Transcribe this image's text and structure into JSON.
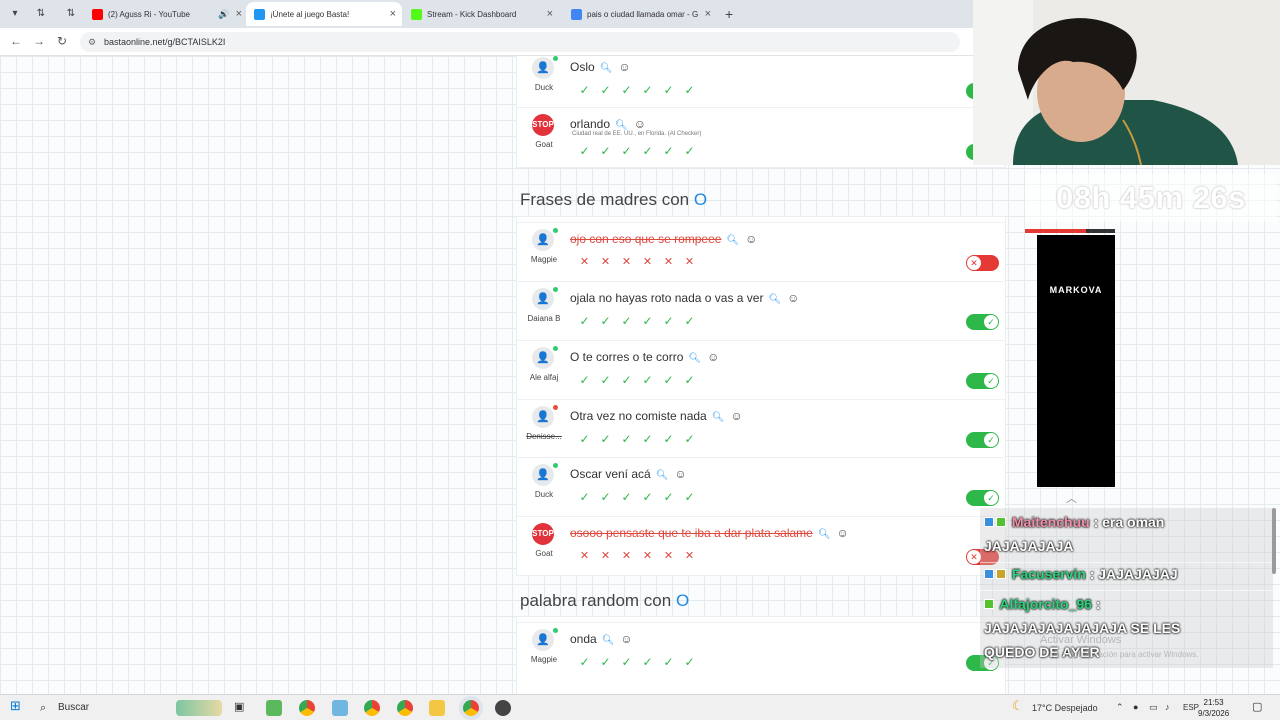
{
  "browser": {
    "tabs": [
      {
        "title": "(2) Aguss Ri - YouTube",
        "color": "#ff0000",
        "active": false,
        "audio": true
      },
      {
        "title": "¡Únete al juego Basta!",
        "color": "#2196f3",
        "active": true,
        "audio": false
      },
      {
        "title": "Stream - Kick Dashboard",
        "color": "#53fc18",
        "active": false,
        "audio": false
      },
      {
        "title": "pais o ciudad llamada omar - G",
        "color": "#4285f4",
        "active": false,
        "audio": false
      }
    ],
    "url": "bastaonline.net/g/BCTAISLK2I"
  },
  "top_rows": [
    {
      "user": "Duck",
      "answer": "Oslo",
      "avatar": "person",
      "valid": true,
      "note": "",
      "dot": "green"
    },
    {
      "user": "Goat",
      "answer": "orlando",
      "avatar": "stop",
      "valid": true,
      "note": "Ciudad real de EE. UU., en Florida. (AI Checker)",
      "dot": "none"
    }
  ],
  "sections": [
    {
      "title": "Frases de madres con",
      "letter": "O",
      "rows": [
        {
          "user": "Magpie",
          "answer": "ojo con eso que se rompeee",
          "avatar": "person",
          "valid": false,
          "dot": "green"
        },
        {
          "user": "Daiana B",
          "answer": "ojala no hayas roto nada o vas a ver",
          "avatar": "person",
          "valid": true,
          "dot": "green"
        },
        {
          "user": "Ale alfaj",
          "answer": "O te corres o te corro",
          "avatar": "person",
          "valid": true,
          "dot": "green"
        },
        {
          "user": "Denisse...",
          "answer": "Otra vez no comiste nada",
          "avatar": "person",
          "valid": true,
          "dot": "red",
          "user_strike": true
        },
        {
          "user": "Duck",
          "answer": "Oscar vení acá",
          "avatar": "person",
          "valid": true,
          "dot": "green"
        },
        {
          "user": "Goat",
          "answer": "osooo pensaste que te iba a dar plata salame",
          "avatar": "stop",
          "valid": false,
          "dot": "none"
        }
      ]
    },
    {
      "title": "palabra random con",
      "letter": "O",
      "rows": [
        {
          "user": "Magpie",
          "answer": "onda",
          "avatar": "person",
          "valid": true,
          "dot": "green"
        }
      ]
    }
  ],
  "stream_overlay": {
    "timer": "08h 45m 26s",
    "timer_progress": 0.68,
    "sponsor": "MARKOVA",
    "chat": [
      {
        "nick": "Maitenchuu",
        "nick_color": "#f08fa8",
        "text": ": era oman",
        "cont": "JAJAJAJAJA"
      },
      {
        "nick": "Facuservin",
        "nick_color": "#2bd47c",
        "text": ": JAJAJAJAJ",
        "cont": ""
      },
      {
        "nick": "Alfajorcito_96",
        "nick_color": "#2bd47c",
        "text": ":",
        "cont": "JAJAJAJAJAJAJAJA SE LES",
        "cont2": "QUEDO DE AYER"
      }
    ],
    "watermark": "Activar Windows",
    "watermark_sub": "Ve a Configuración para activar Windows."
  },
  "taskbar": {
    "search_placeholder": "Buscar",
    "weather": "17°C  Despejado",
    "lang": "ESP",
    "time": "21:53",
    "date": "9/3/2026"
  }
}
